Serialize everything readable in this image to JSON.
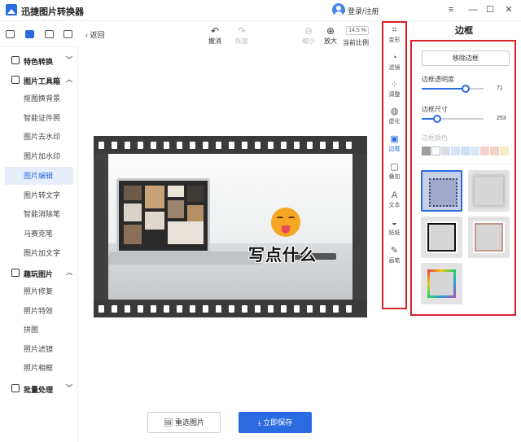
{
  "app": {
    "title": "迅捷图片转换器",
    "login_label": "登录/注册",
    "window_controls": [
      "≡",
      "—",
      "☐",
      "✕"
    ]
  },
  "sidebar": {
    "groups": [
      {
        "label": "特色转换",
        "items": []
      },
      {
        "label": "图片工具箱",
        "items": [
          "抠图换背景",
          "智能证件照",
          "图片去水印",
          "图片加水印",
          "图片编辑",
          "图片转文字",
          "智能消除笔",
          "马赛克笔",
          "图片加文字"
        ]
      },
      {
        "label": "趣玩图片",
        "items": [
          "照片修复",
          "照片特效",
          "拼图",
          "照片滤镜",
          "照片相框"
        ]
      },
      {
        "label": "批量处理",
        "items": []
      }
    ],
    "active_item": "图片编辑"
  },
  "toolbar": {
    "back_label": "返回",
    "undo_label": "撤消",
    "redo_label": "恢复",
    "zoom_out_label": "缩小",
    "zoom_in_label": "放大",
    "zoom_value": "14.5 %",
    "zoom_ratio_label": "当前比例"
  },
  "canvas": {
    "caption_text": "写点什么",
    "reselect_label": "重选图片",
    "save_label": "立即保存"
  },
  "tool_strip": {
    "items": [
      "变形",
      "滤镜",
      "调整",
      "虚化",
      "边框",
      "叠加",
      "文本",
      "贴纸",
      "画笔"
    ],
    "active": "边框",
    "icons": [
      "⌗",
      "◔",
      "⁘",
      "◍",
      "▣",
      "▢",
      "A",
      "◒",
      "✎"
    ]
  },
  "panel": {
    "title": "边框",
    "remove_border_label": "移除边框",
    "opacity_label": "边框透明度",
    "opacity_value": "71",
    "opacity_level": 0.71,
    "size_label": "边框尺寸",
    "size_value": "253",
    "size_level": 0.25,
    "color_label": "边框颜色",
    "colors": [
      "#9e9e9e",
      "#ffffff",
      "#d8dde8",
      "#d6e2f7",
      "#cfe0f5",
      "#d5e8f3",
      "#f6d1d1",
      "#f3d2c4",
      "#f6ecc6"
    ]
  },
  "accent": {
    "primary": "#2b6be0",
    "highlight_box": "#d8202a"
  }
}
